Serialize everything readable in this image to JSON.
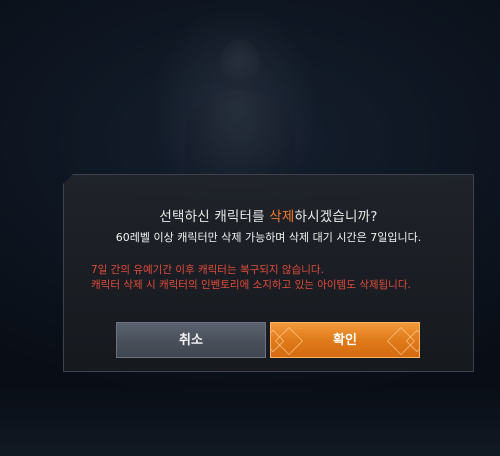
{
  "dialog": {
    "title_before": "선택하신 캐릭터를 ",
    "title_highlight": "삭제",
    "title_after": "하시겠습니까?",
    "subtitle": "60레벨 이상 캐릭터만 삭제 가능하며 삭제 대기 시간은 7일입니다.",
    "warning_line1": "7일 간의 유예기간 이후 캐릭터는 복구되지 않습니다.",
    "warning_line2": "캐릭터 삭제 시 캐릭터의 인벤토리에 소지하고 있는 아이템도 삭제됩니다.",
    "cancel_label": "취소",
    "confirm_label": "확인"
  },
  "colors": {
    "highlight": "#f07a2a",
    "warning": "#e24b3b",
    "confirm_button": "#e07a1a",
    "cancel_button": "#4a515c"
  }
}
